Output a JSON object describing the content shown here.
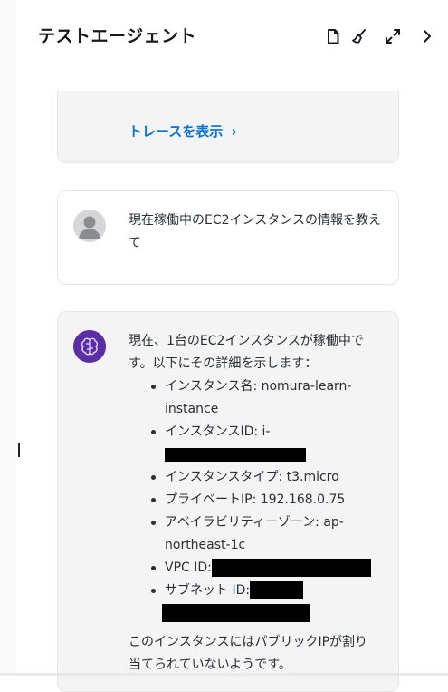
{
  "header": {
    "title": "テストエージェント"
  },
  "trace": {
    "link_label": "トレースを表示",
    "chevron": "›"
  },
  "user_message": {
    "text": "現在稼働中のEC2インスタンスの情報を教えて"
  },
  "agent_message": {
    "intro": "現在、1台のEC2インスタンスが稼働中です。以下にその詳細を示します：",
    "items": [
      {
        "label": "インスタンス名: nomura-learn-instance"
      },
      {
        "label": "インスタンスID: i-"
      },
      {
        "label": "インスタンスタイプ: t3.micro"
      },
      {
        "label": "プライベートIP: 192.168.0.75"
      },
      {
        "label": "アベイラビリティーゾーン: ap-northeast-1c"
      },
      {
        "label": "VPC ID:"
      },
      {
        "label": "サブネット ID:"
      }
    ],
    "outro": "このインスタンスにはパブリックIPが割り当てられていないようです。"
  },
  "icons": {
    "document": "document-icon",
    "clear": "broom-icon",
    "expand": "expand-icon",
    "close": "chevron-right-icon"
  },
  "colors": {
    "link": "#0972d3",
    "agent_avatar": "#5b2ea6",
    "card_bg": "#f4f4f5"
  }
}
